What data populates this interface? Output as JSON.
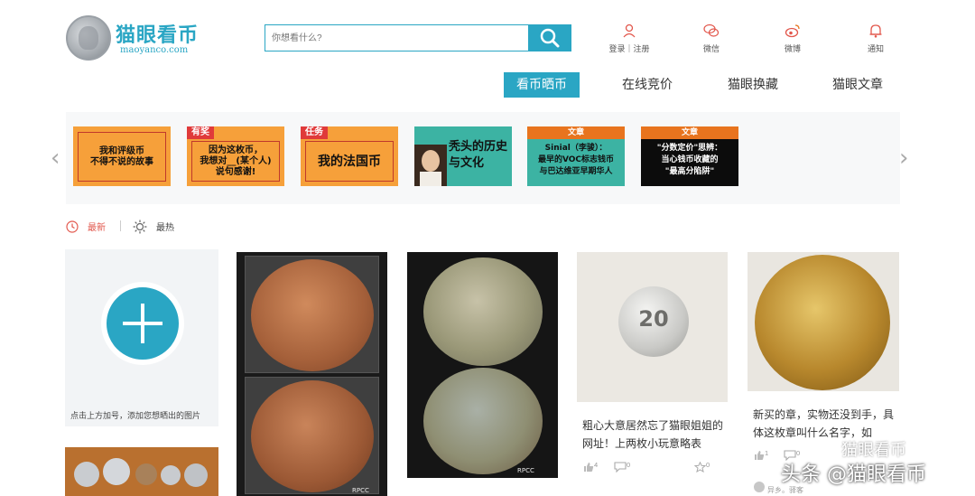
{
  "header": {
    "logo_text": "猫眼看币",
    "logo_url": "maoyanco.com",
    "search_placeholder": "你想看什么?",
    "links": [
      {
        "label": "登录｜注册",
        "icon": "user-icon"
      },
      {
        "label": "微信",
        "icon": "wechat-icon"
      },
      {
        "label": "微博",
        "icon": "weibo-icon"
      },
      {
        "label": "通知",
        "icon": "bell-icon"
      }
    ]
  },
  "nav": {
    "items": [
      "看币晒币",
      "在线竞价",
      "猫眼换藏",
      "猫眼文章"
    ],
    "active": "看币晒币"
  },
  "banner": {
    "cards": [
      {
        "text": "我和评级币\n不得不说的故事",
        "tag": "",
        "topbar": ""
      },
      {
        "text": "因为这枚币，\n我想对__(某个人)\n说句感谢!",
        "tag": "有奖",
        "topbar": ""
      },
      {
        "text": "我的法国币",
        "tag": "任务",
        "topbar": ""
      },
      {
        "text": "秃头的历史\n与文化",
        "tag": "",
        "topbar": ""
      },
      {
        "text": "Sinial（李骏）：\n最早的VOC标志钱币\n与巴达维亚早期华人",
        "tag": "",
        "topbar": "文章"
      },
      {
        "text": "\"分数定价\"思辨：\n当心钱币收藏的\n\"最高分陷阱\"",
        "tag": "",
        "topbar": "文章"
      }
    ]
  },
  "filter": {
    "latest": "最新",
    "hottest": "最热"
  },
  "upload": {
    "hint": "点击上方加号，添加您想晒出的图片"
  },
  "posts": [
    {
      "watermark": "RPCC"
    },
    {
      "watermark": "RPCC"
    },
    {
      "text": "粗心大意居然忘了猫眼姐姐的网址！上两枚小玩意略表",
      "likes": "4",
      "comments": "0",
      "stars": "0",
      "coin_label": "20"
    },
    {
      "text": "新买的章，实物还没到手，具体这枚章叫什么名字，如",
      "likes": "1",
      "comments": "0",
      "user": "异乡。驿客"
    }
  ],
  "watermark": {
    "line1": "猫眼看币",
    "line2": "头条 @猫眼看币"
  },
  "colors": {
    "accent": "#2aa6c4",
    "orange": "#f6a03a",
    "red_tag": "#e03a3a"
  }
}
